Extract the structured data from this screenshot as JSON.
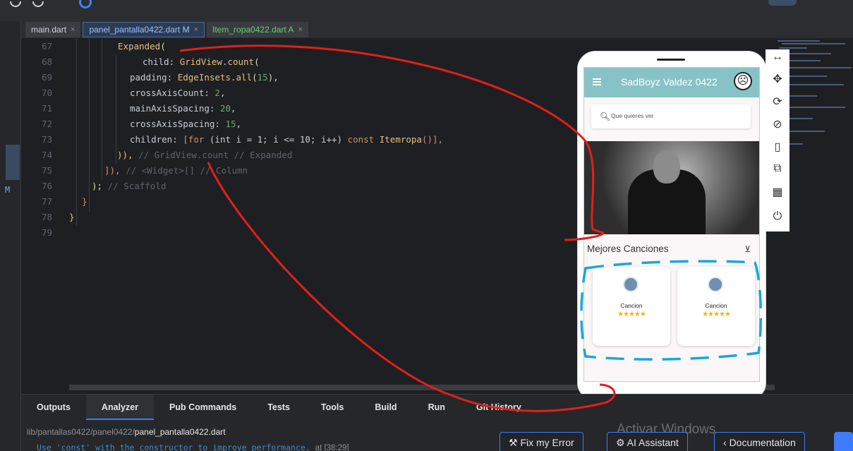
{
  "tabs": [
    {
      "label": "main.dart",
      "state": "normal"
    },
    {
      "label": "panel_pantalla0422.dart M",
      "state": "active"
    },
    {
      "label": "Item_ropa0422.dart A",
      "state": "added"
    }
  ],
  "tab_close": "×",
  "leftstrip": {
    "marker": "M"
  },
  "code_lines": [
    {
      "n": "67"
    },
    {
      "n": "68"
    },
    {
      "n": "69"
    },
    {
      "n": "70"
    },
    {
      "n": "71"
    },
    {
      "n": "72"
    },
    {
      "n": "73"
    },
    {
      "n": "74"
    },
    {
      "n": "75"
    },
    {
      "n": "76"
    },
    {
      "n": "77"
    },
    {
      "n": "78"
    },
    {
      "n": "79"
    }
  ],
  "code": {
    "l67": {
      "fn": "Expanded",
      "p": "("
    },
    "l68": {
      "prop": "child: ",
      "fn": "GridView",
      "dot": ".",
      "fn2": "count",
      "p": "("
    },
    "l69": {
      "prop": "padding: ",
      "fn": "EdgeInsets",
      "dot": ".",
      "fn2": "all",
      "p": "(",
      "num": "15",
      "p2": "),"
    },
    "l70": {
      "prop": "crossAxisCount: ",
      "num": "2",
      "p": ","
    },
    "l71": {
      "prop": "mainAxisSpacing: ",
      "num": "20",
      "p": ","
    },
    "l72": {
      "prop": "crossAxisSpacing: ",
      "num": "15",
      "p": ","
    },
    "l73": {
      "prop": "children: ",
      "p": "[",
      "kw": "for",
      "rest": " (int i = 1; i <= 10; i++) ",
      "kw2": "const",
      "fn": " Itemropa",
      "p2": "()],"
    },
    "l74": {
      "p": ")),",
      "cm": " // GridView.count // Expanded"
    },
    "l75": {
      "p": "]),",
      "cm": " // <Widget>[] // Column"
    },
    "l76": {
      "p": ");",
      "cm": " // Scaffold"
    },
    "l77": {
      "p": "}"
    },
    "l78": {
      "p": "}"
    }
  },
  "phone": {
    "app_title": "SadBoyz Valdez 0422",
    "face": "☹",
    "search_placeholder": "Que quieres ver",
    "search_icon": "magnifier-icon",
    "section_title": "Mejores Canciones",
    "filter_icon": "filter-off-icon",
    "filter_glyph": "⊻",
    "cards": [
      {
        "label": "Cancion",
        "stars": "★★★★★"
      },
      {
        "label": "Cancion",
        "stars": "★★★★★"
      }
    ]
  },
  "devtools": {
    "glyphs": [
      "↔",
      "✥",
      "⟳",
      "⊘",
      "▯",
      "⧉",
      "▦",
      "⏻"
    ]
  },
  "bottom_tabs": [
    "Outputs",
    "Analyzer",
    "Pub Commands",
    "Tests",
    "Tools",
    "Build",
    "Run",
    "Git History"
  ],
  "analyzer": {
    "path_prefix": "lib/pantallas0422/panel0422/",
    "path_file": "panel_pantalla0422.dart",
    "warning": "Use 'const' with the constructor to improve performance.",
    "location": "at [38:29]"
  },
  "actions": {
    "fix": "Fix my Error",
    "ai": "AI Assistant",
    "docs": "Documentation"
  },
  "watermark": "Activar Windows",
  "colors": {
    "accent": "#3d7cff",
    "appbar": "#87c3c6",
    "annotation_red": "#e0201b",
    "annotation_cyan": "#1aa7d8"
  }
}
